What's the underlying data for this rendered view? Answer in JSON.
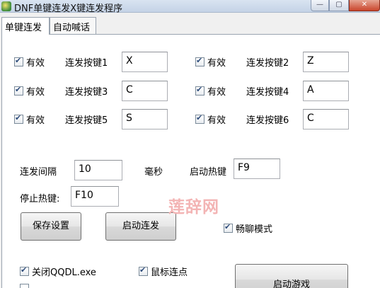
{
  "window": {
    "title": "DNF单键连发X键连发程序",
    "buttons": [
      "—",
      "▢",
      "✕"
    ]
  },
  "tabs": [
    {
      "label": "单键连发",
      "active": true
    },
    {
      "label": "自动喊话",
      "active": false
    }
  ],
  "keys": [
    {
      "enabled_label": "有效",
      "label": "连发按键1",
      "value": "X",
      "checked": true
    },
    {
      "enabled_label": "有效",
      "label": "连发按键2",
      "value": "Z",
      "checked": true
    },
    {
      "enabled_label": "有效",
      "label": "连发按键3",
      "value": "C",
      "checked": true
    },
    {
      "enabled_label": "有效",
      "label": "连发按键4",
      "value": "A",
      "checked": true
    },
    {
      "enabled_label": "有效",
      "label": "连发按键5",
      "value": "S",
      "checked": true
    },
    {
      "enabled_label": "有效",
      "label": "连发按键6",
      "value": "C",
      "checked": true
    }
  ],
  "settings": {
    "interval_label": "连发间隔",
    "interval_value": "10",
    "interval_unit": "毫秒",
    "start_hotkey_label": "启动热键",
    "start_hotkey_value": "F9",
    "stop_hotkey_label": "停止热键:",
    "stop_hotkey_value": "F10"
  },
  "actions": {
    "save_label": "保存设置",
    "start_label": "启动连发",
    "chat_mode_label": "畅聊模式",
    "chat_mode_checked": true
  },
  "options": {
    "close_qqdl_label": "关闭QQDL.exe",
    "close_qqdl_checked": true,
    "mouse_click_label": "鼠标连点",
    "mouse_click_checked": true,
    "launch_game_label": "启动游戏"
  },
  "watermark": "莲辞网"
}
